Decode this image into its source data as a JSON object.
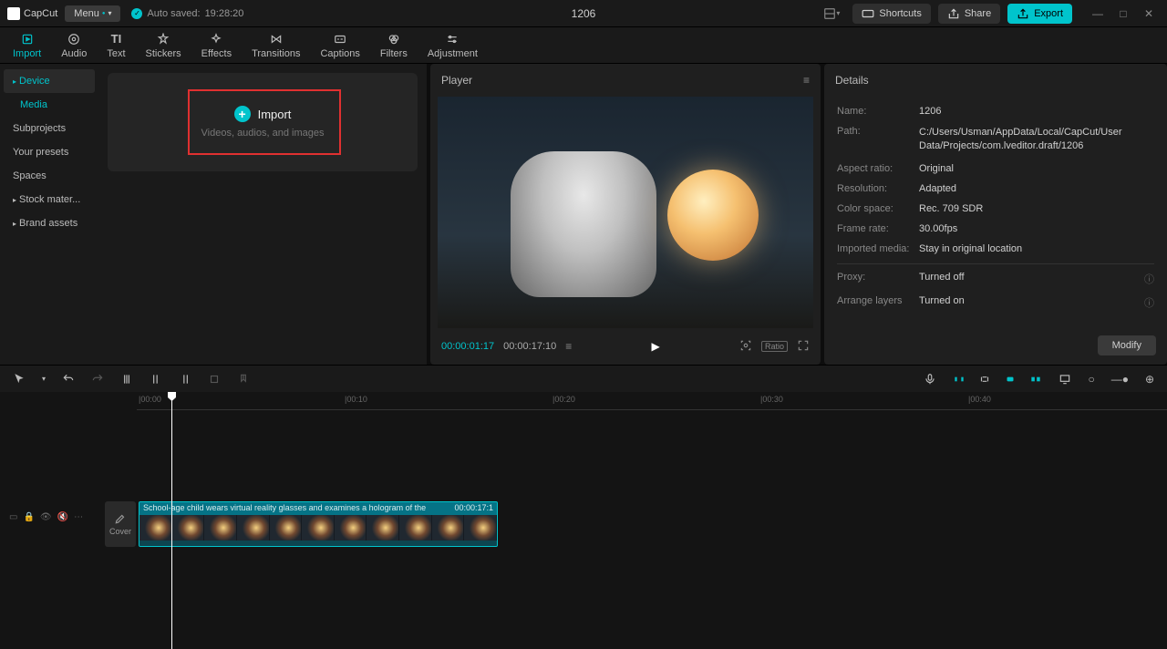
{
  "app": {
    "name": "CapCut",
    "project_title": "1206"
  },
  "titlebar": {
    "menu": "Menu",
    "autosave_prefix": "Auto saved:",
    "autosave_time": "19:28:20",
    "shortcuts": "Shortcuts",
    "share": "Share",
    "export": "Export"
  },
  "tabs": [
    {
      "id": "import",
      "label": "Import"
    },
    {
      "id": "audio",
      "label": "Audio"
    },
    {
      "id": "text",
      "label": "Text"
    },
    {
      "id": "stickers",
      "label": "Stickers"
    },
    {
      "id": "effects",
      "label": "Effects"
    },
    {
      "id": "transitions",
      "label": "Transitions"
    },
    {
      "id": "captions",
      "label": "Captions"
    },
    {
      "id": "filters",
      "label": "Filters"
    },
    {
      "id": "adjustment",
      "label": "Adjustment"
    }
  ],
  "sidebar": {
    "items": [
      {
        "label": "Device",
        "expandable": true,
        "active": true
      },
      {
        "label": "Media",
        "sub": true
      },
      {
        "label": "Subprojects"
      },
      {
        "label": "Your presets"
      },
      {
        "label": "Spaces"
      },
      {
        "label": "Stock mater...",
        "expandable": true
      },
      {
        "label": "Brand assets",
        "expandable": true
      }
    ]
  },
  "import_box": {
    "title": "Import",
    "subtitle": "Videos, audios, and images"
  },
  "player": {
    "title": "Player",
    "current_time": "00:00:01:17",
    "total_time": "00:00:17:10",
    "ratio_label": "Ratio"
  },
  "details": {
    "title": "Details",
    "rows": [
      {
        "label": "Name:",
        "value": "1206"
      },
      {
        "label": "Path:",
        "value": "C:/Users/Usman/AppData/Local/CapCut/User Data/Projects/com.lveditor.draft/1206"
      },
      {
        "label": "Aspect ratio:",
        "value": "Original"
      },
      {
        "label": "Resolution:",
        "value": "Adapted"
      },
      {
        "label": "Color space:",
        "value": "Rec. 709 SDR"
      },
      {
        "label": "Frame rate:",
        "value": "30.00fps"
      },
      {
        "label": "Imported media:",
        "value": "Stay in original location"
      }
    ],
    "rows2": [
      {
        "label": "Proxy:",
        "value": "Turned off"
      },
      {
        "label": "Arrange layers",
        "value": "Turned on"
      }
    ],
    "modify": "Modify"
  },
  "timeline": {
    "ruler": [
      "|00:00",
      "|00:10",
      "|00:20",
      "|00:30",
      "|00:40"
    ],
    "cover": "Cover",
    "clip_label": "School-age child wears virtual reality glasses and examines a hologram of the",
    "clip_duration": "00:00:17:1"
  }
}
